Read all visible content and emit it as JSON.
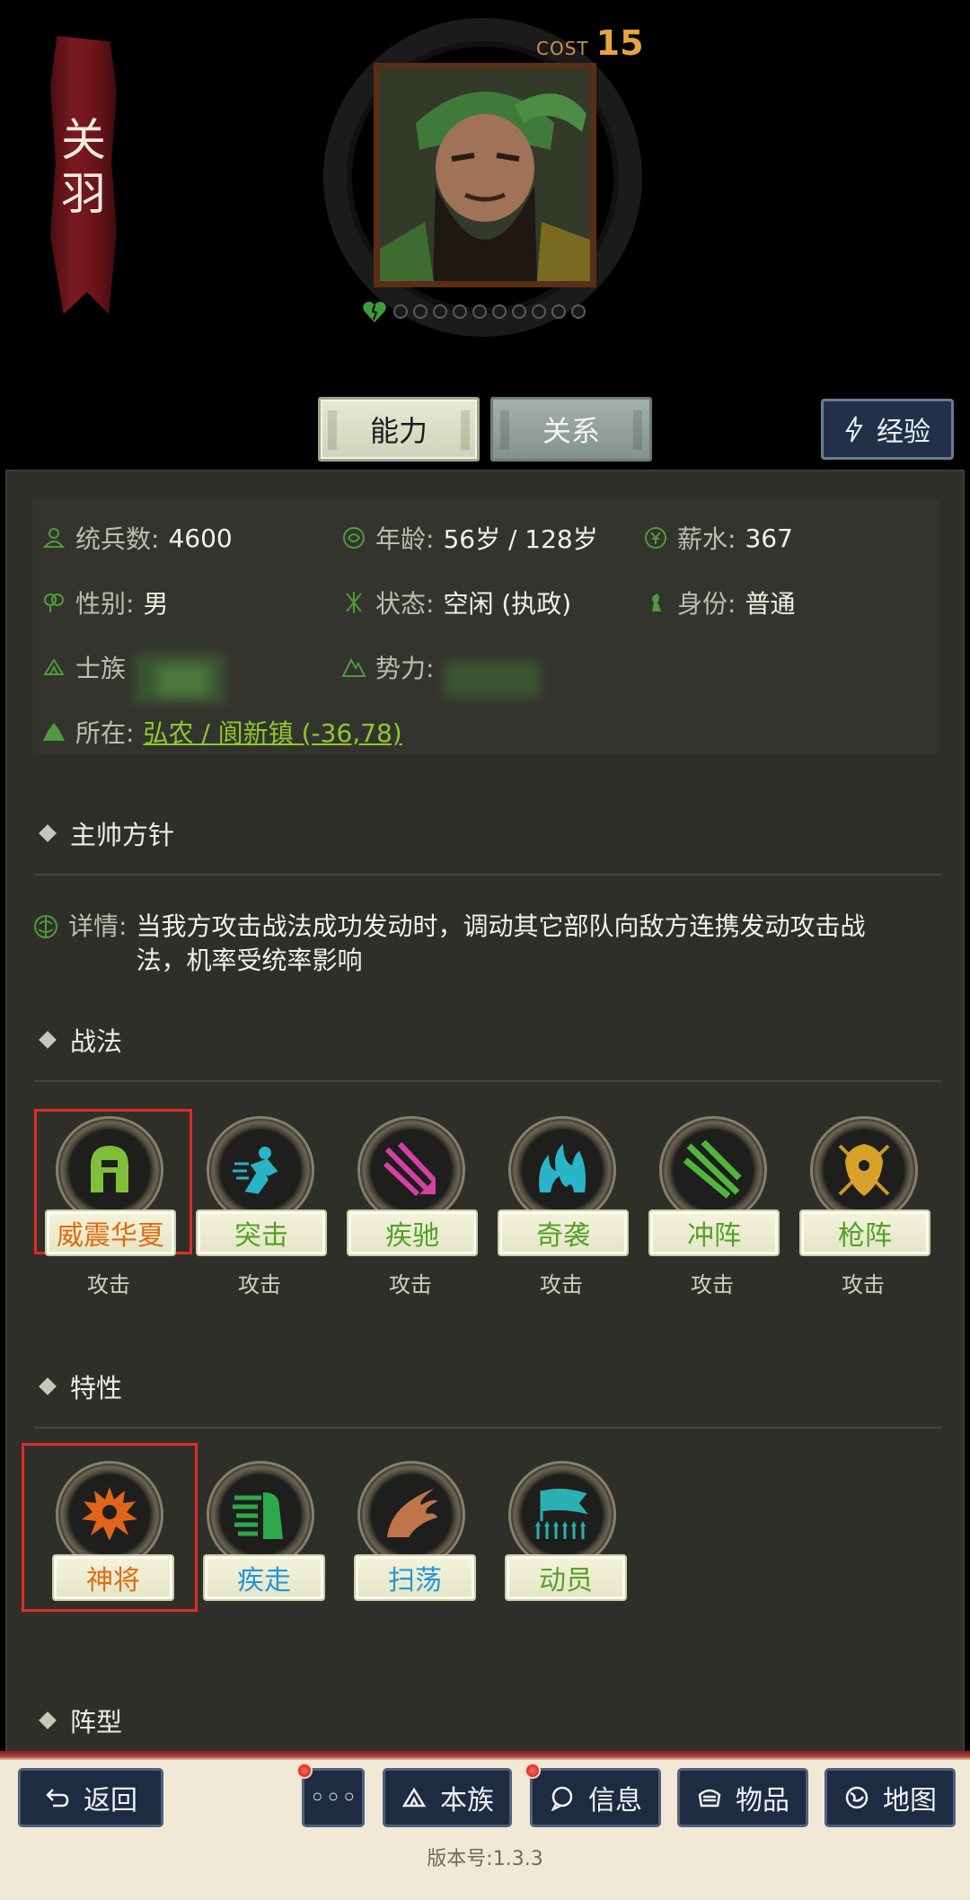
{
  "hero": {
    "name_chars": [
      "关",
      "羽"
    ],
    "cost_label": "COST",
    "cost_value": "15",
    "loyalty_dots": 10
  },
  "tabs": {
    "ability": "能力",
    "relation": "关系",
    "experience": "经验"
  },
  "info": {
    "troops_label": "统兵数:",
    "troops_value": "4600",
    "age_label": "年龄:",
    "age_value": "56岁 / 128岁",
    "salary_label": "薪水:",
    "salary_value": "367",
    "gender_label": "性别:",
    "gender_value": "男",
    "status_label": "状态:",
    "status_value": "空闲 (执政)",
    "identity_label": "身份:",
    "identity_value": "普通",
    "clan_label": "士族",
    "faction_label": "势力:",
    "location_label": "所在:",
    "location_value": "弘农 / 阆新镇 (-36,78)"
  },
  "strategy": {
    "title": "主帅方针",
    "detail_label": "详情:",
    "detail_text": "当我方攻击战法成功发动时，调动其它部队向敌方连携发动攻击战法，机率受统率影响"
  },
  "tactics": {
    "title": "战法",
    "items": [
      {
        "name": "威震华夏",
        "type": "攻击",
        "color": "#e26a12"
      },
      {
        "name": "突击",
        "type": "攻击",
        "color": "#55a02a"
      },
      {
        "name": "疾驰",
        "type": "攻击",
        "color": "#55a02a"
      },
      {
        "name": "奇袭",
        "type": "攻击",
        "color": "#55a02a"
      },
      {
        "name": "冲阵",
        "type": "攻击",
        "color": "#55a02a"
      },
      {
        "name": "枪阵",
        "type": "攻击",
        "color": "#55a02a"
      }
    ]
  },
  "traits": {
    "title": "特性",
    "items": [
      {
        "name": "神将",
        "color": "#e26a12"
      },
      {
        "name": "疾走",
        "color": "#2496d8"
      },
      {
        "name": "扫荡",
        "color": "#2496d8"
      },
      {
        "name": "动员",
        "color": "#55a02a"
      }
    ]
  },
  "formation": {
    "title": "阵型"
  },
  "footer": {
    "back": "返回",
    "more": "◦◦◦",
    "clan": "本族",
    "message": "信息",
    "items": "物品",
    "map": "地图",
    "version": "版本号:1.3.3"
  }
}
